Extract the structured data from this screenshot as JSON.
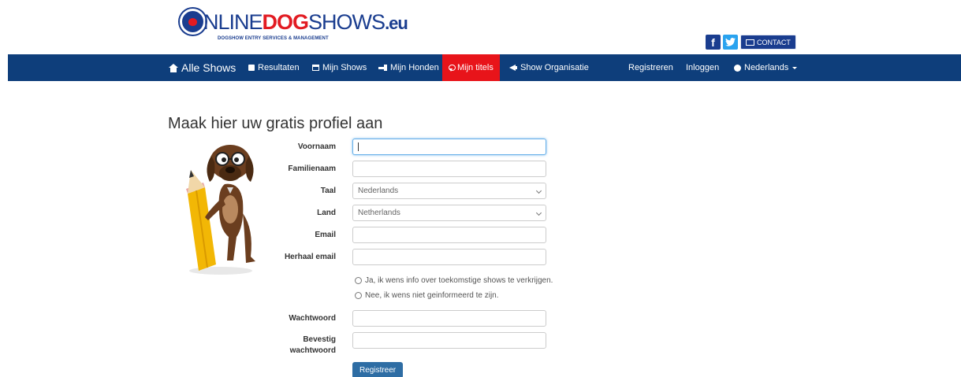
{
  "logo": {
    "text_a": "NLINE",
    "text_b": "DOG",
    "text_c": "SHOWS",
    "text_d": ".eu",
    "tagline": "DOGSHOW ENTRY SERVICES & MANAGEMENT"
  },
  "header": {
    "facebook": "f",
    "twitter": "t",
    "contact_label": "CONTACT"
  },
  "nav": {
    "all_shows": "Alle Shows",
    "results": "Resultaten",
    "my_shows": "Mijn Shows",
    "my_dogs": "Mijn Honden",
    "my_titles": "Mijn titels",
    "show_org": "Show Organisatie",
    "register": "Registreren",
    "login": "Inloggen",
    "language": "Nederlands"
  },
  "colors": {
    "nav_bg": "#0e3e7b",
    "active_tab": "#e8141a",
    "primary_button": "#2e6da4",
    "brand_red": "#e21b22",
    "brand_blue": "#1a3d8f"
  },
  "form": {
    "title": "Maak hier uw gratis profiel aan",
    "first_name_label": "Voornaam",
    "first_name_value": "",
    "last_name_label": "Familienaam",
    "last_name_value": "",
    "language_label": "Taal",
    "language_value": "Nederlands",
    "country_label": "Land",
    "country_value": "Netherlands",
    "email_label": "Email",
    "email_value": "",
    "repeat_email_label": "Herhaal email",
    "repeat_email_value": "",
    "radio_yes": "Ja, ik wens info over toekomstige shows te verkrijgen.",
    "radio_no": "Nee, ik wens niet geinformeerd te zijn.",
    "password_label": "Wachtwoord",
    "confirm_password_label_1": "Bevestig",
    "confirm_password_label_2": "wachtwoord",
    "submit_label": "Registreer"
  }
}
